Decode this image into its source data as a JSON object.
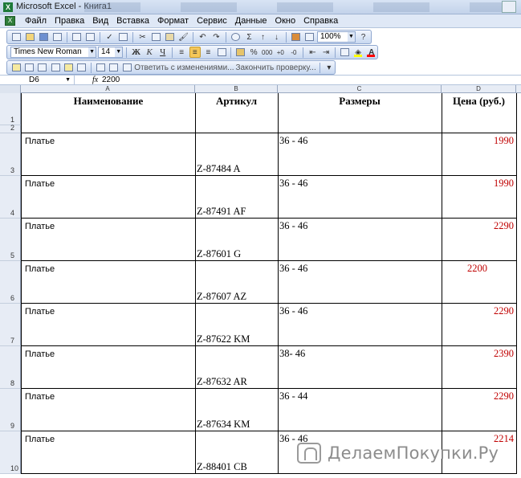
{
  "window": {
    "title": "Microsoft Excel - Книга1"
  },
  "menu": {
    "items": [
      "Файл",
      "Правка",
      "Вид",
      "Вставка",
      "Формат",
      "Сервис",
      "Данные",
      "Окно",
      "Справка"
    ]
  },
  "toolbar": {
    "zoom": "100%",
    "font_name": "Times New Roman",
    "font_size": "14",
    "bold_label": "Ж",
    "italic_label": "К",
    "underline_label": "Ч",
    "percent_label": "%",
    "thousands_label": "000",
    "sum_label": "Σ",
    "review_reply": "Ответить с изменениями...",
    "review_end": "Закончить проверку...",
    "fill_color": "#ffff00",
    "font_color": "#ff0000"
  },
  "formula_bar": {
    "cell_ref": "D6",
    "fx_label": "fx",
    "value": "2200"
  },
  "columns": [
    "A",
    "B",
    "C",
    "D"
  ],
  "sheet": {
    "headers": {
      "name": "Наименование",
      "article": "Артикул",
      "sizes": "Размеры",
      "price": "Цена (руб.)"
    },
    "header_rows": [
      "1",
      "2"
    ],
    "rows": [
      {
        "row": "3",
        "name": "Платье",
        "article": "Z-87484 A",
        "sizes": "36 - 46",
        "price": "1990"
      },
      {
        "row": "4",
        "name": "Платье",
        "article": "Z-87491 AF",
        "sizes": "36 - 46",
        "price": "1990"
      },
      {
        "row": "5",
        "name": "Платье",
        "article": "Z-87601 G",
        "sizes": "36 - 46",
        "price": "2290"
      },
      {
        "row": "6",
        "name": "Платье",
        "article": "Z-87607 AZ",
        "sizes": "36 - 46",
        "price": "2200"
      },
      {
        "row": "7",
        "name": "Платье",
        "article": "Z-87622 KM",
        "sizes": "36 - 46",
        "price": "2290"
      },
      {
        "row": "8",
        "name": "Платье",
        "article": "Z-87632 AR",
        "sizes": "38- 46",
        "price": "2390"
      },
      {
        "row": "9",
        "name": "Платье",
        "article": "Z-87634 KM",
        "sizes": "36 - 44",
        "price": "2290"
      },
      {
        "row": "10",
        "name": "Платье",
        "article": "Z-88401 CB",
        "sizes": "36 - 46",
        "price": "2214"
      }
    ],
    "price_color": "#c00000"
  },
  "watermark": {
    "text": "ДелаемПокупки.Ру"
  }
}
